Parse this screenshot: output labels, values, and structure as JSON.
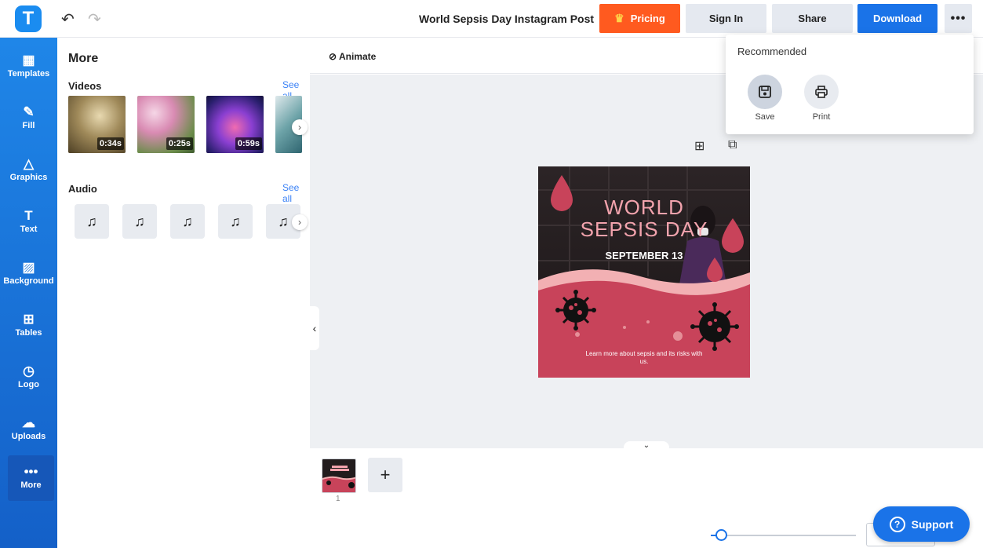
{
  "header": {
    "logo_letter": "T",
    "doc_title": "World Sepsis Day Instagram Post",
    "pricing_label": "Pricing",
    "signin_label": "Sign In",
    "share_label": "Share",
    "download_label": "Download",
    "more_label": "•••"
  },
  "nav": {
    "items": [
      {
        "label": "Templates",
        "icon": "▦"
      },
      {
        "label": "Fill",
        "icon": "✎"
      },
      {
        "label": "Graphics",
        "icon": "△"
      },
      {
        "label": "Text",
        "icon": "T"
      },
      {
        "label": "Background",
        "icon": "▨"
      },
      {
        "label": "Tables",
        "icon": "⊞"
      },
      {
        "label": "Logo",
        "icon": "◷"
      },
      {
        "label": "Uploads",
        "icon": "☁"
      },
      {
        "label": "More",
        "icon": "•••"
      }
    ]
  },
  "panel": {
    "title": "More",
    "videos": {
      "title": "Videos",
      "see_all": "See all",
      "items": [
        {
          "duration": "0:34s"
        },
        {
          "duration": "0:25s"
        },
        {
          "duration": "0:59s"
        }
      ]
    },
    "audio": {
      "title": "Audio",
      "see_all": "See all",
      "icon": "♫"
    }
  },
  "workspace": {
    "animate_label": "Animate",
    "collapse_icon": "‹",
    "add_icon": "⊞",
    "duplicate_icon": "⧉",
    "bottom_icon": "⌄"
  },
  "design": {
    "title_line1": "WORLD",
    "title_line2": "SEPSIS DAY",
    "date": "SEPTEMBER 13",
    "caption": "Learn more about sepsis and its risks with us."
  },
  "pages": {
    "current": "1",
    "add_icon": "+"
  },
  "zoom": {
    "level_fraction": 0.07
  },
  "support": {
    "label": "Support",
    "icon": "?"
  },
  "dropdown": {
    "title": "Recommended",
    "save_label": "Save",
    "print_label": "Print"
  },
  "colors": {
    "accent": "#1a73e8",
    "pricing": "#ff5a1f",
    "design_pink": "#c8435a"
  }
}
